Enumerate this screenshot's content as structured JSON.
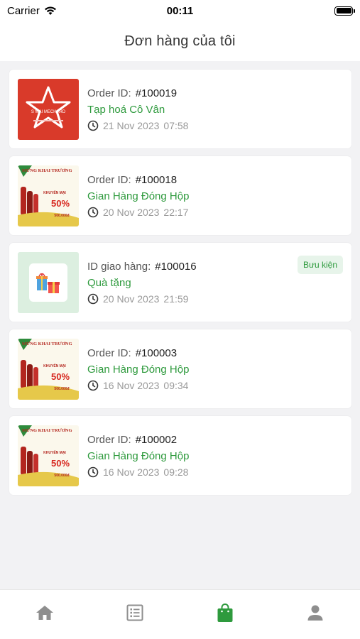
{
  "status_bar": {
    "carrier": "Carrier",
    "time": "00:11"
  },
  "header": {
    "title": "Đơn hàng của tôi"
  },
  "orders": [
    {
      "id_label": "Order ID:",
      "id": "#100019",
      "store": "Tạp hoá Cô Vân",
      "date": "21 Nov 2023",
      "time": "07:58",
      "thumb": "star-logo",
      "thumb_text": "S MAI MECHARD"
    },
    {
      "id_label": "Order ID:",
      "id": "#100018",
      "store": "Gian Hàng Đóng Hộp",
      "date": "20 Nov 2023",
      "time": "22:17",
      "thumb": "promo-banner",
      "thumb_text": [
        "MỪNG KHAI TRƯƠNG",
        "KHUYẾN MẠI",
        "50%",
        "500.000đ"
      ]
    },
    {
      "id_label": "ID giao hàng:",
      "id": "#100016",
      "store": "Quà tặng",
      "date": "20 Nov 2023",
      "time": "21:59",
      "thumb": "gift",
      "badge": "Bưu kiện"
    },
    {
      "id_label": "Order ID:",
      "id": "#100003",
      "store": "Gian Hàng Đóng Hộp",
      "date": "16 Nov 2023",
      "time": "09:34",
      "thumb": "promo-banner",
      "thumb_text": [
        "MỪNG KHAI TRƯƠNG",
        "KHUYẾN MẠI",
        "50%",
        "500.000đ"
      ]
    },
    {
      "id_label": "Order ID:",
      "id": "#100002",
      "store": "Gian Hàng Đóng Hộp",
      "date": "16 Nov 2023",
      "time": "09:28",
      "thumb": "promo-banner",
      "thumb_text": [
        "MỪNG KHAI TRƯƠNG",
        "KHUYẾN MẠI",
        "50%",
        "500.000đ"
      ]
    }
  ],
  "tabs": [
    {
      "icon": "home-icon",
      "active": false
    },
    {
      "icon": "list-icon",
      "active": false
    },
    {
      "icon": "shopping-bag-icon",
      "active": true
    },
    {
      "icon": "user-icon",
      "active": false
    }
  ],
  "colors": {
    "accent": "#2e9a3d",
    "inactive_icon": "#8e8e8e",
    "badge_bg": "#e7f4ea",
    "star_bg": "#d93a2a"
  }
}
